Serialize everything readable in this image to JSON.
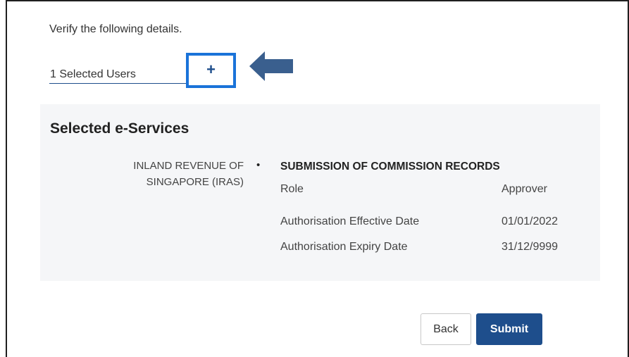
{
  "instruction": "Verify the following details.",
  "users": {
    "selected_label": "1 Selected Users",
    "expand_symbol": "+"
  },
  "services": {
    "title": "Selected e-Services",
    "agency_line1": "INLAND REVENUE OF",
    "agency_line2": "SINGAPORE (IRAS)",
    "bullet": "•",
    "service_name": "SUBMISSION OF COMMISSION RECORDS",
    "rows": [
      {
        "label": "Role",
        "value": "Approver"
      },
      {
        "label": "Authorisation Effective Date",
        "value": "01/01/2022"
      },
      {
        "label": "Authorisation Expiry Date",
        "value": "31/12/9999"
      }
    ]
  },
  "buttons": {
    "back": "Back",
    "submit": "Submit"
  },
  "colors": {
    "primary": "#1e4e8c",
    "highlight_box": "#1a73d9",
    "arrow": "#3a5f8e",
    "panel_bg": "#f5f6f8"
  },
  "icons": {
    "annotation_arrow": "left-arrow-icon"
  }
}
